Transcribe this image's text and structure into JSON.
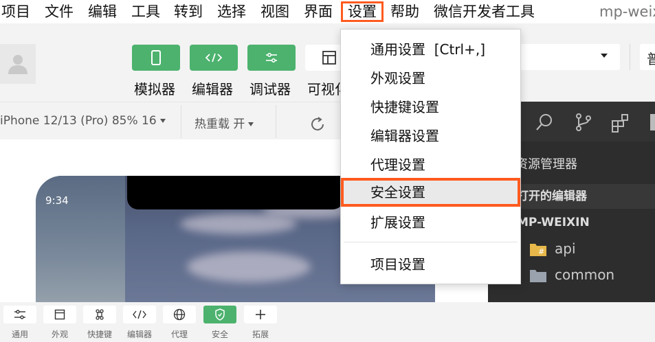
{
  "menubar": {
    "items": [
      "项目",
      "文件",
      "编辑",
      "工具",
      "转到",
      "选择",
      "视图",
      "界面",
      "设置",
      "帮助",
      "微信开发者工具"
    ],
    "active_index": 8,
    "app_title": "mp-weix"
  },
  "toolbar": {
    "buttons": [
      {
        "label": "模拟器",
        "icon": "phone-icon",
        "active": true
      },
      {
        "label": "编辑器",
        "icon": "code-icon",
        "active": true
      },
      {
        "label": "调试器",
        "icon": "sliders-icon",
        "active": true
      },
      {
        "label": "可视化",
        "icon": "layout-icon",
        "active": false
      }
    ],
    "partial_button_text": "普"
  },
  "devicebar": {
    "device": "iPhone 12/13 (Pro) 85% 16",
    "hot_reload": "热重载 开"
  },
  "simulator": {
    "status_time": "9:34"
  },
  "explorer": {
    "title": "资源管理器",
    "open_editors": "打开的编辑器",
    "project": "MP-WEIXIN",
    "tree": [
      "api",
      "common"
    ]
  },
  "dropdown": {
    "items": [
      {
        "label": "通用设置",
        "shortcut": "[Ctrl+,]"
      },
      {
        "label": "外观设置"
      },
      {
        "label": "快捷键设置"
      },
      {
        "label": "编辑器设置"
      },
      {
        "label": "代理设置"
      },
      {
        "label": "安全设置",
        "highlighted": true
      },
      {
        "label": "扩展设置"
      },
      {
        "label": "项目设置"
      }
    ]
  },
  "bottombar": {
    "items": [
      {
        "label": "通用",
        "icon": "sliders-icon"
      },
      {
        "label": "外观",
        "icon": "window-icon"
      },
      {
        "label": "快捷键",
        "icon": "command-icon"
      },
      {
        "label": "编辑器",
        "icon": "code-icon"
      },
      {
        "label": "代理",
        "icon": "globe-icon"
      },
      {
        "label": "安全",
        "icon": "shield-icon",
        "active": true
      },
      {
        "label": "拓展",
        "icon": "plus-icon"
      }
    ]
  },
  "colors": {
    "accent": "#4cb26e",
    "highlight": "#ff5a1f",
    "explorer_bg": "#2d2d2d"
  }
}
